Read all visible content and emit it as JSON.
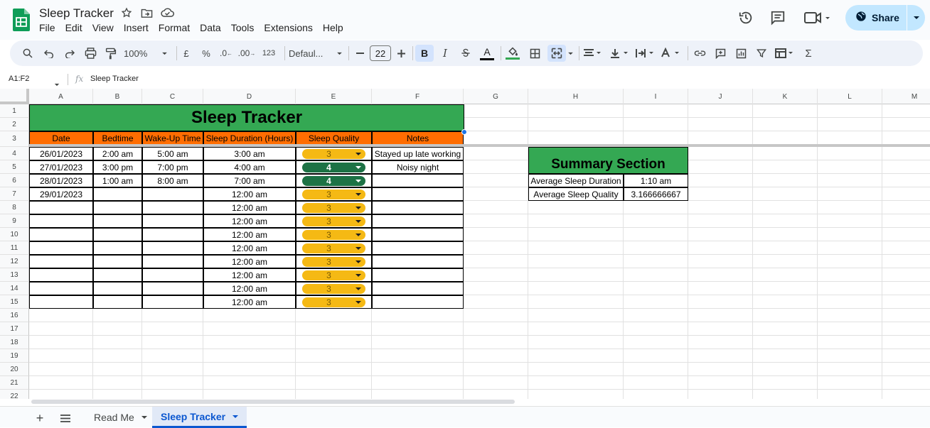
{
  "app": {
    "doc_title": "Sleep Tracker",
    "menu": [
      "File",
      "Edit",
      "View",
      "Insert",
      "Format",
      "Data",
      "Tools",
      "Extensions",
      "Help"
    ],
    "share_label": "Share"
  },
  "toolbar": {
    "zoom": "100%",
    "currency": "£",
    "percent": "%",
    "decrease_decimals": ".0",
    "increase_decimals": ".00",
    "number_format": "123",
    "font": "Defaul...",
    "font_size": "22",
    "bold": "B",
    "italic": "I",
    "text_color_label": "A",
    "sum": "Σ"
  },
  "formula_bar": {
    "name_box": "A1:F2",
    "fx": "fx",
    "content": "Sleep Tracker"
  },
  "columns": [
    "A",
    "B",
    "C",
    "D",
    "E",
    "F",
    "G",
    "H",
    "I",
    "J",
    "K",
    "L",
    "M"
  ],
  "rows": [
    "1",
    "2",
    "3",
    "4",
    "5",
    "6",
    "7",
    "8",
    "9",
    "10",
    "11",
    "12",
    "13",
    "14",
    "15",
    "16",
    "17",
    "18",
    "19",
    "20",
    "21",
    "22"
  ],
  "sheet": {
    "title": "Sleep Tracker",
    "headers": [
      "Date",
      "Bedtime",
      "Wake-Up Time",
      "Sleep Duration (Hours)",
      "Sleep Quality",
      "Notes"
    ],
    "entries": [
      [
        "26/01/2023",
        "2:00 am",
        "5:00 am",
        "3:00 am",
        "3",
        "Stayed up late working"
      ],
      [
        "27/01/2023",
        "3:00 pm",
        "7:00 pm",
        "4:00 am",
        "4",
        "Noisy night"
      ],
      [
        "28/01/2023",
        "1:00 am",
        "8:00 am",
        "7:00 am",
        "4",
        ""
      ],
      [
        "29/01/2023",
        "",
        "",
        "12:00 am",
        "3",
        ""
      ],
      [
        "",
        "",
        "",
        "12:00 am",
        "3",
        ""
      ],
      [
        "",
        "",
        "",
        "12:00 am",
        "3",
        ""
      ],
      [
        "",
        "",
        "",
        "12:00 am",
        "3",
        ""
      ],
      [
        "",
        "",
        "",
        "12:00 am",
        "3",
        ""
      ],
      [
        "",
        "",
        "",
        "12:00 am",
        "3",
        ""
      ],
      [
        "",
        "",
        "",
        "12:00 am",
        "3",
        ""
      ],
      [
        "",
        "",
        "",
        "12:00 am",
        "3",
        ""
      ],
      [
        "",
        "",
        "",
        "12:00 am",
        "3",
        ""
      ]
    ],
    "quality_colors": {
      "3": "#f5b914",
      "4": "#1d7245"
    },
    "summary": {
      "title": "Summary Section",
      "rows": [
        [
          "Average Sleep Duration",
          "1:10 am"
        ],
        [
          "Average Sleep Quality",
          "3.166666667"
        ]
      ]
    }
  },
  "tabs": {
    "add": "+",
    "sheets": [
      {
        "name": "Read Me",
        "active": false
      },
      {
        "name": "Sleep Tracker",
        "active": true
      }
    ]
  },
  "colors": {
    "banner_green": "#34a853",
    "header_orange": "#ff6d01",
    "accent_blue": "#0b57d0",
    "share_bg": "#c2e7ff"
  }
}
